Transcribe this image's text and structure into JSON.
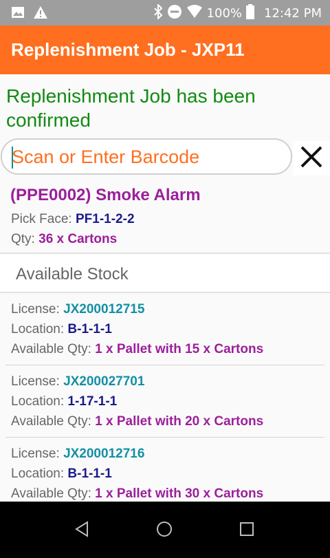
{
  "status_bar": {
    "battery": "100%",
    "time": "12:42 PM"
  },
  "app_bar": {
    "title": "Replenishment Job - JXP11"
  },
  "message": "Replenishment Job has been confirmed",
  "search": {
    "placeholder": "Scan or Enter Barcode",
    "value": ""
  },
  "product": {
    "title": "(PPE0002) Smoke Alarm",
    "pick_face_label": "Pick Face:",
    "pick_face_value": "PF1-1-2-2",
    "qty_label": "Qty:",
    "qty_value": "36 x Cartons"
  },
  "available_stock": {
    "heading": "Available Stock",
    "items": [
      {
        "license_label": "License:",
        "license": "JX200012715",
        "location_label": "Location:",
        "location": "B-1-1-1",
        "qty_label": "Available Qty:",
        "qty": "1 x Pallet with 15 x Cartons"
      },
      {
        "license_label": "License:",
        "license": "JX200027701",
        "location_label": "Location:",
        "location": "1-17-1-1",
        "qty_label": "Available Qty:",
        "qty": "1 x Pallet with 20 x Cartons"
      },
      {
        "license_label": "License:",
        "license": "JX200012716",
        "location_label": "Location:",
        "location": "B-1-1-1",
        "qty_label": "Available Qty:",
        "qty": "1 x Pallet with 30 x Cartons"
      }
    ]
  },
  "colors": {
    "accent": "#ff6f1f",
    "confirm": "#128a12",
    "product": "#9b1f9b",
    "license": "#1290a6",
    "location": "#1a1a8a"
  }
}
